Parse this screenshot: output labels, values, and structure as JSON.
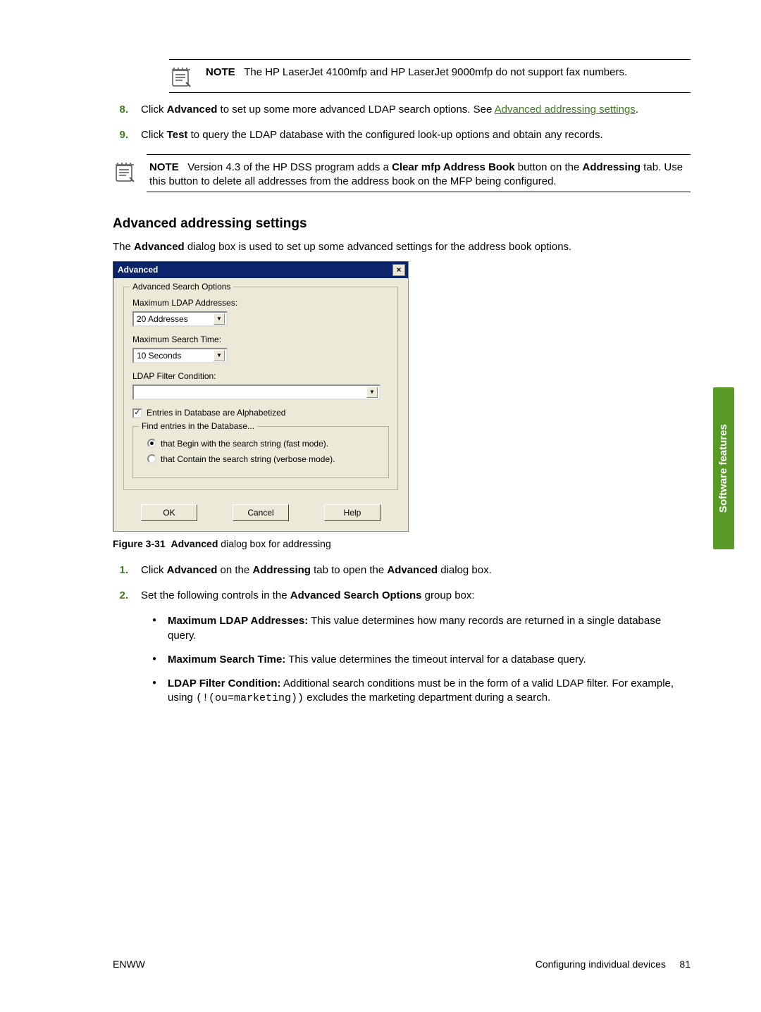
{
  "notes": {
    "top": {
      "label": "NOTE",
      "text": "The HP LaserJet 4100mfp and HP LaserJet 9000mfp do not support fax numbers."
    },
    "mid": {
      "label": "NOTE",
      "text_prefix": "Version 4.3 of the HP DSS program adds a ",
      "bold_mid": "Clear mfp Address Book",
      "text_mid2": " button on the ",
      "bold_tab": "Addressing",
      "text_suffix": " tab. Use this button to delete all addresses from the address book on the MFP being configured."
    }
  },
  "steps_top": [
    {
      "num": "8.",
      "parts": {
        "a": "Click ",
        "b": "Advanced",
        "c": " to set up some more advanced LDAP search options. See ",
        "link": "Advanced addressing settings",
        "d": "."
      }
    },
    {
      "num": "9.",
      "parts": {
        "a": "Click ",
        "b": "Test",
        "c": " to query the LDAP database with the configured look-up options and obtain any records."
      }
    }
  ],
  "heading": "Advanced addressing settings",
  "intro": {
    "a": "The ",
    "b": "Advanced",
    "c": " dialog box is used to set up some advanced settings for the address book options."
  },
  "dialog": {
    "title": "Advanced",
    "group1": {
      "legend": "Advanced Search Options",
      "max_ldap_label": "Maximum LDAP Addresses:",
      "max_ldap_value": "20 Addresses",
      "max_time_label": "Maximum Search Time:",
      "max_time_value": "10 Seconds",
      "filter_label": "LDAP Filter Condition:",
      "filter_value": "",
      "alpha_check": "Entries in Database are Alphabetized"
    },
    "group2": {
      "legend": "Find entries in the Database...",
      "radio1": "that Begin with the search string (fast mode).",
      "radio2": "that Contain the search string (verbose mode)."
    },
    "buttons": {
      "ok": "OK",
      "cancel": "Cancel",
      "help": "Help"
    }
  },
  "figure_caption": {
    "label": "Figure 3-31",
    "bold": "Advanced",
    "rest": " dialog box for addressing"
  },
  "steps_bottom": [
    {
      "num": "1.",
      "parts": {
        "a": "Click ",
        "b": "Advanced",
        "c": " on the ",
        "d": "Addressing",
        "e": " tab to open the ",
        "f": "Advanced",
        "g": " dialog box."
      }
    },
    {
      "num": "2.",
      "parts": {
        "a": "Set the following controls in the ",
        "b": "Advanced Search Options",
        "c": " group box:"
      }
    }
  ],
  "bullets": [
    {
      "bold": "Maximum LDAP Addresses:",
      "text": " This value determines how many records are returned in a single database query."
    },
    {
      "bold": "Maximum Search Time:",
      "text": " This value determines the timeout interval for a database query."
    },
    {
      "bold": "LDAP Filter Condition:",
      "text_a": " Additional search conditions must be in the form of a valid LDAP filter. For example, using ",
      "code": "(!(ou=marketing))",
      "text_b": " excludes the marketing department during a search."
    }
  ],
  "footer": {
    "left": "ENWW",
    "right_label": "Configuring individual devices",
    "page": "81"
  },
  "sidetab": "Software features"
}
